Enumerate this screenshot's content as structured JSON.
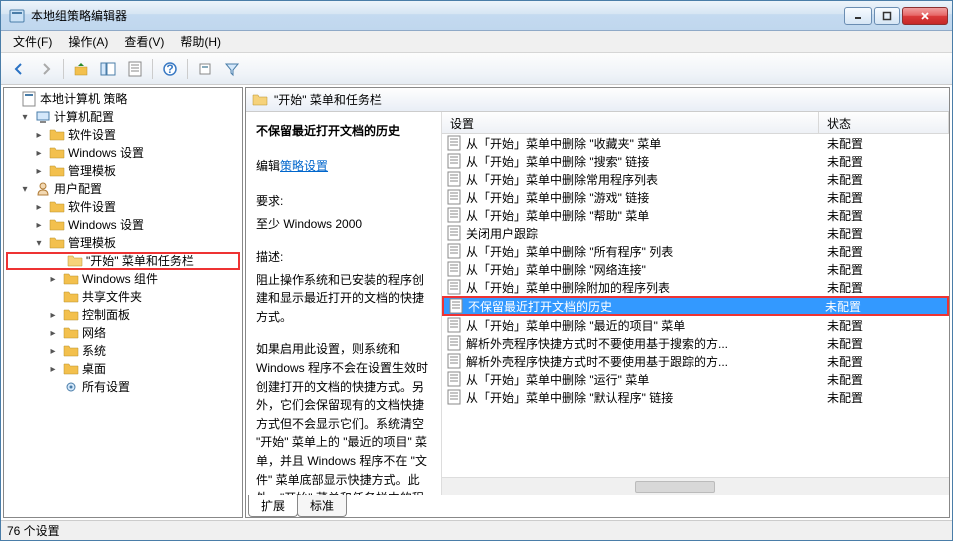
{
  "window": {
    "title": "本地组策略编辑器"
  },
  "menu": {
    "file": "文件(F)",
    "action": "操作(A)",
    "view": "查看(V)",
    "help": "帮助(H)"
  },
  "tree": {
    "root": "本地计算机 策略",
    "computer_config": "计算机配置",
    "user_config": "用户配置",
    "software_settings": "软件设置",
    "windows_settings": "Windows 设置",
    "admin_templates": "管理模板",
    "start_taskbar": "\"开始\" 菜单和任务栏",
    "windows_components": "Windows 组件",
    "shared_folders": "共享文件夹",
    "control_panel": "控制面板",
    "network": "网络",
    "system": "系统",
    "desktop": "桌面",
    "all_settings": "所有设置"
  },
  "header": {
    "title": "\"开始\" 菜单和任务栏"
  },
  "detail": {
    "title": "不保留最近打开文档的历史",
    "edit_prefix": "编辑",
    "edit_link": "策略设置",
    "req_label": "要求:",
    "req_text": "至少 Windows 2000",
    "desc_label": "描述:",
    "desc_p1": "阻止操作系统和已安装的程序创建和显示最近打开的文档的快捷方式。",
    "desc_p2": "如果启用此设置，则系统和 Windows 程序不会在设置生效时创建打开的文档的快捷方式。另外，它们会保留现有的文档快捷方式但不会显示它们。系统清空 \"开始\" 菜单上的 \"最近的项目\" 菜单，并且 Windows 程序不在 \"文件\" 菜单底部显示快捷方式。此外，\"开始\" 菜单和任务栏中的程"
  },
  "list": {
    "col_setting": "设置",
    "col_state": "状态",
    "rows": [
      {
        "s": "从「开始」菜单中删除 \"收藏夹\" 菜单",
        "t": "未配置"
      },
      {
        "s": "从「开始」菜单中删除 \"搜索\" 链接",
        "t": "未配置"
      },
      {
        "s": "从「开始」菜单中删除常用程序列表",
        "t": "未配置"
      },
      {
        "s": "从「开始」菜单中删除 \"游戏\" 链接",
        "t": "未配置"
      },
      {
        "s": "从「开始」菜单中删除 \"帮助\" 菜单",
        "t": "未配置"
      },
      {
        "s": "关闭用户跟踪",
        "t": "未配置"
      },
      {
        "s": "从「开始」菜单中删除 \"所有程序\" 列表",
        "t": "未配置"
      },
      {
        "s": "从「开始」菜单中删除 \"网络连接\"",
        "t": "未配置"
      },
      {
        "s": "从「开始」菜单中删除附加的程序列表",
        "t": "未配置"
      },
      {
        "s": "不保留最近打开文档的历史",
        "t": "未配置"
      },
      {
        "s": "从「开始」菜单中删除 \"最近的项目\" 菜单",
        "t": "未配置"
      },
      {
        "s": "解析外壳程序快捷方式时不要使用基于搜索的方...",
        "t": "未配置"
      },
      {
        "s": "解析外壳程序快捷方式时不要使用基于跟踪的方...",
        "t": "未配置"
      },
      {
        "s": "从「开始」菜单中删除 \"运行\" 菜单",
        "t": "未配置"
      },
      {
        "s": "从「开始」菜单中删除 \"默认程序\" 链接",
        "t": "未配置"
      }
    ],
    "selected_index": 9
  },
  "tabs": {
    "extended": "扩展",
    "standard": "标准"
  },
  "status": {
    "text": "76 个设置"
  }
}
